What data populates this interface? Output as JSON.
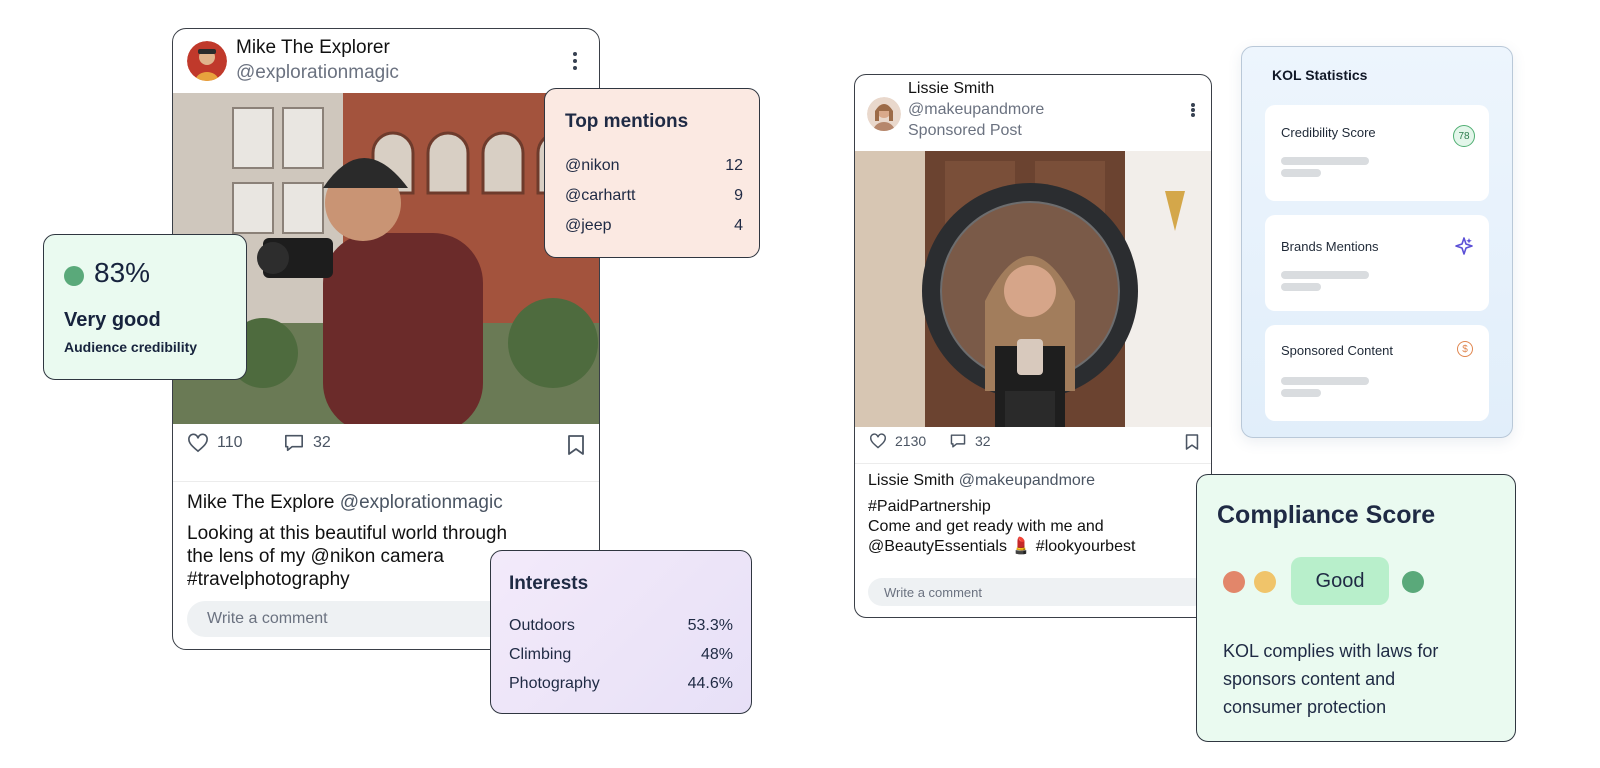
{
  "post1": {
    "name": "Mike The Explorer",
    "handle": "@explorationmagic",
    "likes": "110",
    "comments": "32",
    "caption_name": "Mike The Explore",
    "caption_handle": "@explorationmagic",
    "caption_text_line1": "Looking at this beautiful world through",
    "caption_text_line2": "the lens of my @nikon camera",
    "caption_text_line3": "#travelphotography",
    "comment_placeholder": "Write a comment"
  },
  "credibility": {
    "value": "83%",
    "rating": "Very good",
    "label": "Audience credibility",
    "color": "#5aa97a"
  },
  "top_mentions": {
    "title": "Top mentions",
    "items": [
      {
        "handle": "@nikon",
        "count": "12"
      },
      {
        "handle": "@carhartt",
        "count": "9"
      },
      {
        "handle": "@jeep",
        "count": "4"
      }
    ]
  },
  "interests": {
    "title": "Interests",
    "items": [
      {
        "label": "Outdoors",
        "value": "53.3%"
      },
      {
        "label": "Climbing",
        "value": "48%"
      },
      {
        "label": "Photography",
        "value": "44.6%"
      }
    ]
  },
  "post2": {
    "name": "Lissie Smith",
    "handle": "@makeupandmore",
    "sponsored": "Sponsored Post",
    "likes": "2130",
    "comments": "32",
    "caption_name": "Lissie Smith",
    "caption_handle": "@makeupandmore",
    "caption_line1": "#PaidPartnership",
    "caption_line2": "Come and get ready with me and",
    "caption_line3": "@BeautyEssentials 💄 #lookyourbest",
    "comment_placeholder": "Write a comment"
  },
  "kol_statistics": {
    "title": "KOL Statistics",
    "items": [
      {
        "label": "Credibility Score",
        "badge": "78",
        "icon": "score-badge"
      },
      {
        "label": "Brands Mentions",
        "icon": "sparkle-icon"
      },
      {
        "label": "Sponsored Content",
        "icon": "dollar-icon"
      }
    ]
  },
  "compliance": {
    "title": "Compliance Score",
    "status": "Good",
    "description_line1": "KOL complies with laws for",
    "description_line2": "sponsors content and",
    "description_line3": "consumer protection"
  }
}
